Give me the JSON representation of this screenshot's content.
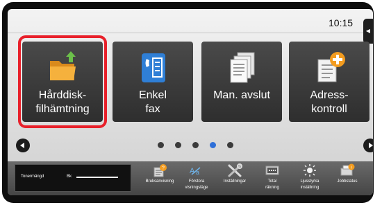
{
  "status": {
    "time": "10:15"
  },
  "tiles": [
    {
      "line1": "Hårddisk-",
      "line2": "filhämtning"
    },
    {
      "line1": "Enkel",
      "line2": "fax"
    },
    {
      "line1": "Man. avslut",
      "line2": ""
    },
    {
      "line1": "Adress-",
      "line2": "kontroll"
    }
  ],
  "pagination": {
    "total": 5,
    "current": 4
  },
  "toner": {
    "label": "Tonermängd",
    "color": "Bk"
  },
  "quick": [
    {
      "line1": "Bruksanvisning",
      "line2": ""
    },
    {
      "line1": "Förstora",
      "line2": "visningsläge"
    },
    {
      "line1": "Inställningar",
      "line2": ""
    },
    {
      "line1": "Total",
      "line2": "räkning"
    },
    {
      "line1": "Ljusstyrka",
      "line2": "inställning"
    },
    {
      "line1": "Jobbstatus",
      "line2": ""
    }
  ],
  "colors": {
    "selection": "#e8202a",
    "active_dot": "#2e6fd8",
    "accent_orange": "#f39c1f",
    "accent_blue": "#2f7fd6"
  }
}
